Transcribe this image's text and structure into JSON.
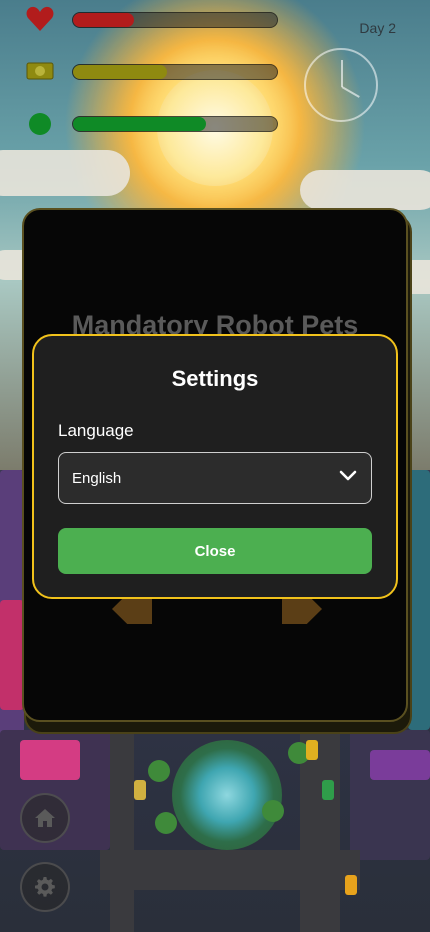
{
  "hud": {
    "health_icon": "heart-icon",
    "health_level": 0.3,
    "money_icon": "cash-icon",
    "money_level": 0.46,
    "energy_icon": "energy-icon",
    "energy_level": 0.65,
    "day_label": "Day 2",
    "clock_icon": "clock-icon"
  },
  "card": {
    "title": "Mandatory Robot Pets",
    "prev_icon": "arrow-left-icon",
    "next_icon": "arrow-right-icon"
  },
  "settings": {
    "title": "Settings",
    "language_label": "Language",
    "language_value": "English",
    "close_label": "Close"
  },
  "side_buttons": {
    "home_icon": "home-icon",
    "settings_icon": "gear-icon"
  },
  "colors": {
    "modal_border": "#f1c21b",
    "close_button": "#4caf50",
    "health_bar": "#b21c1c",
    "money_bar": "#8f8a10",
    "energy_bar": "#0f8a26"
  }
}
